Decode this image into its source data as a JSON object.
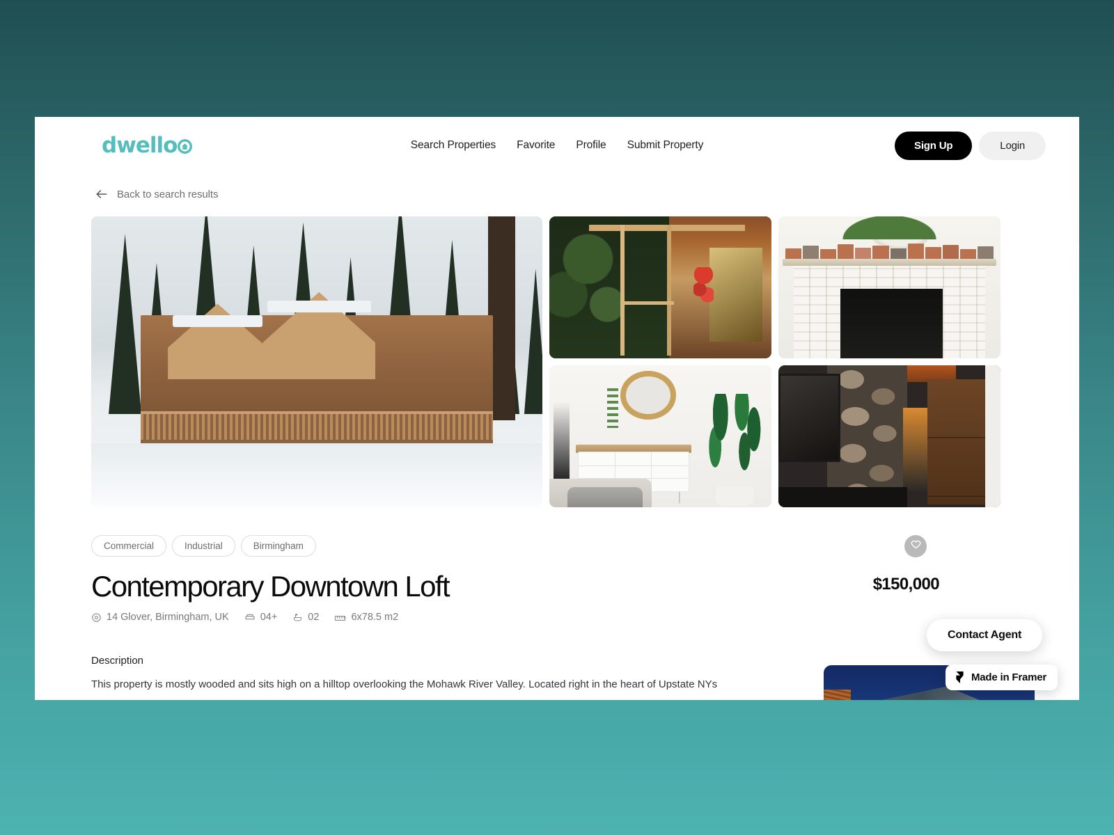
{
  "brand": {
    "name": "dwello",
    "logo_color": "#56bdbd",
    "logo_icon": "house-in-o-icon"
  },
  "header": {
    "nav": [
      {
        "label": "Search Properties",
        "name": "nav-search-properties"
      },
      {
        "label": "Favorite",
        "name": "nav-favorite"
      },
      {
        "label": "Profile",
        "name": "nav-profile"
      },
      {
        "label": "Submit Property",
        "name": "nav-submit-property"
      }
    ],
    "signup_label": "Sign Up",
    "login_label": "Login",
    "signup_bg": "#000000",
    "login_bg": "#f0f0f0"
  },
  "back_link": {
    "label": "Back to search results",
    "icon": "arrow-left-icon"
  },
  "gallery": {
    "main_alt": "Wooden chalet in snow surrounded by pine trees",
    "thumbs": [
      {
        "alt": "Wooden pergola and garden entrance"
      },
      {
        "alt": "White stone fireplace with potted plants on mantel"
      },
      {
        "alt": "Bedroom with round mirror, sideboard and palm plant"
      },
      {
        "alt": "Stone wall with mounted TV and wooden cabinetry"
      }
    ]
  },
  "listing": {
    "tags": [
      "Commercial",
      "Industrial",
      "Birmingham"
    ],
    "title": "Contemporary Downtown Loft",
    "price": "$150,000",
    "favorite_icon": "heart-icon",
    "meta": [
      {
        "icon": "location-pin-icon",
        "value": "14 Glover, Birmingham, UK"
      },
      {
        "icon": "bed-icon",
        "value": "04+"
      },
      {
        "icon": "bath-icon",
        "value": "02"
      },
      {
        "icon": "area-ruler-icon",
        "value": "6x78.5 m2"
      }
    ],
    "description_heading": "Description",
    "description_body": "This property is mostly wooded and sits high on a hilltop overlooking the Mohawk River Valley. Located right in the heart of Upstate NYs"
  },
  "side_card": {
    "alt": "Modern blue-grey apartment building against night sky"
  },
  "floating": {
    "contact_agent_label": "Contact Agent",
    "framer_label": "Made in Framer",
    "framer_icon": "framer-logo-icon"
  }
}
